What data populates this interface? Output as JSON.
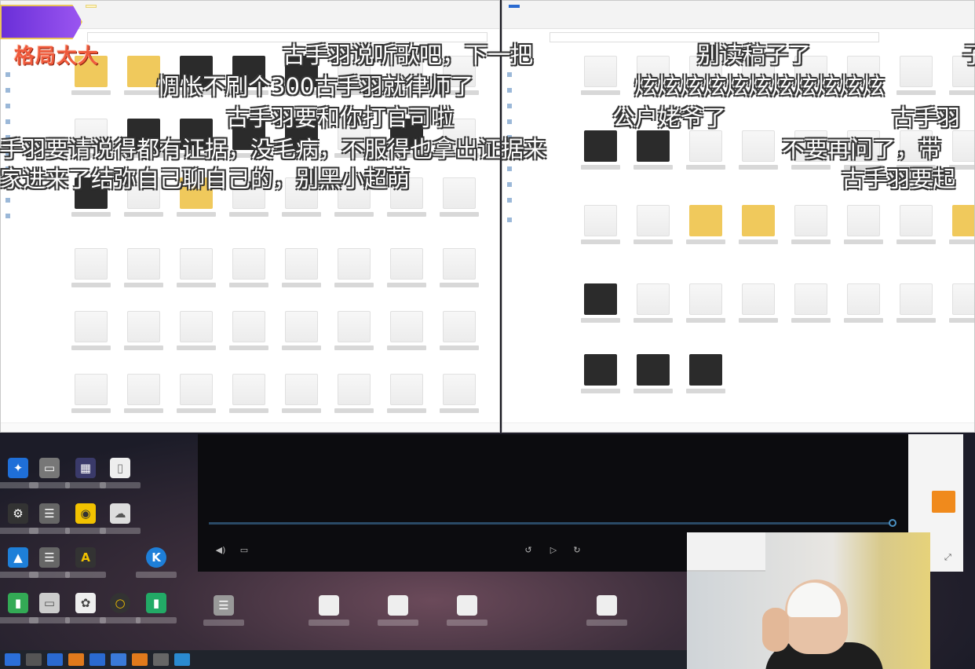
{
  "overlay": {
    "badge": "格局太大"
  },
  "danmaku": [
    "古手羽说听歌吧，下一把",
    "别读稿子了",
    "惆怅不刷个300古手羽就律师了",
    "炫炫炫炫炫炫炫炫炫炫炫",
    "古手羽要和你打官司啦",
    "公户姥爷了",
    "古手羽",
    "手羽要请说得都有证据，没毛病，不服得也拿出证据来",
    "不要再问了，带",
    "家进来了结弥自己聊自己的，别黑小超萌",
    "古手羽要起",
    "子"
  ],
  "colors": {
    "badge_purple": "#7a3ee0",
    "badge_text": "#ef5a3c",
    "danmu": "#ffffff",
    "progress": "#4a90c2",
    "accent_orange": "#f08a1c"
  },
  "player": {
    "progress": 1.0
  },
  "icons": [
    "volume-icon",
    "subtitle-icon",
    "rewind-icon",
    "play-icon",
    "forward-icon",
    "expand-icon"
  ]
}
